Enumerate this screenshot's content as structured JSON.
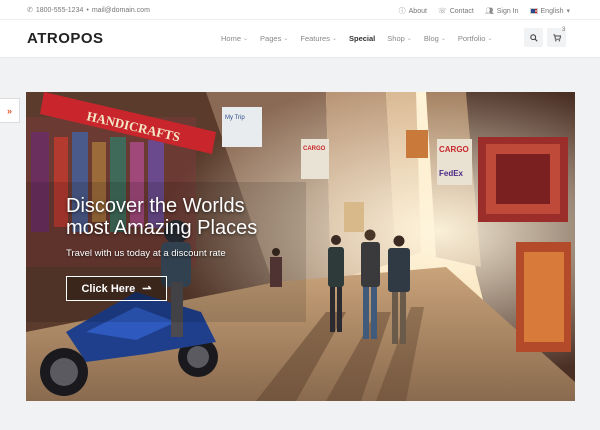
{
  "topbar": {
    "phone": "1800-555-1234",
    "separator": "•",
    "email": "mail@domain.com",
    "about": "About",
    "contact": "Contact",
    "signin": "Sign In",
    "language": "English"
  },
  "header": {
    "logo": "ATROPOS",
    "nav": [
      {
        "label": "Home",
        "active": false
      },
      {
        "label": "Pages",
        "active": false
      },
      {
        "label": "Features",
        "active": false
      },
      {
        "label": "Special",
        "active": true
      },
      {
        "label": "Shop",
        "active": false
      },
      {
        "label": "Blog",
        "active": false
      },
      {
        "label": "Portfolio",
        "active": false
      }
    ],
    "cart_count": "3"
  },
  "side_toggle": {
    "icon": "double-chevron-right-icon",
    "glyph": "»"
  },
  "hero": {
    "title_line1": "Discover the Worlds",
    "title_line2": "most Amazing Places",
    "subtitle": "Travel with us today at a discount rate",
    "cta": "Click Here",
    "cta_arrow": "⇀",
    "sign_text": "HANDICRAFTS",
    "sign_cargo": "CARGO",
    "sign_fedex": "FedEx",
    "sign_trip": "My Trip"
  },
  "colors": {
    "accent": "#e65a2b",
    "dark": "#222222"
  }
}
